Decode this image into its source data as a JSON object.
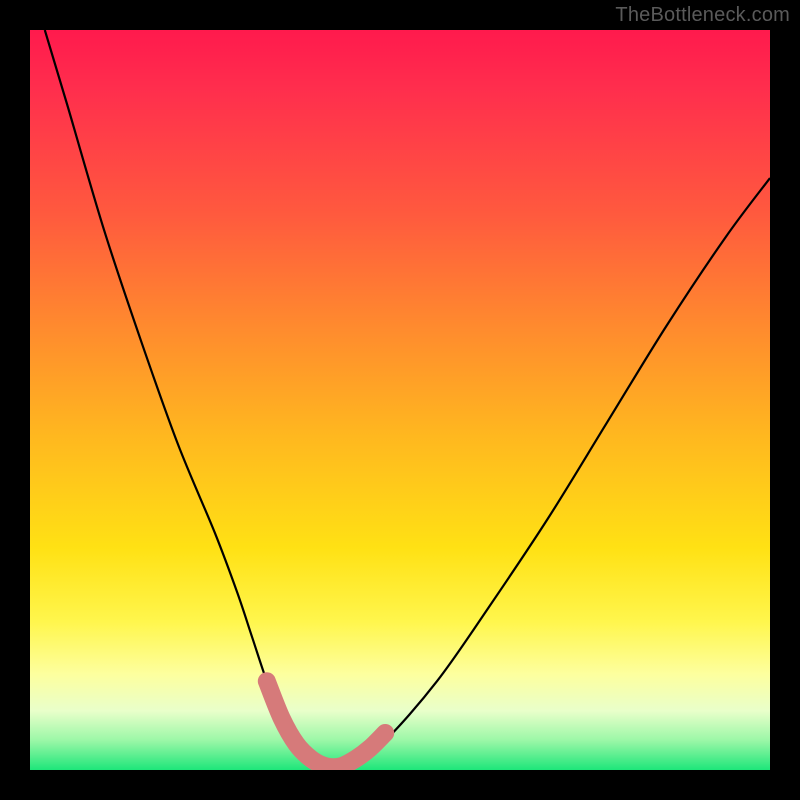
{
  "watermark": "TheBottleneck.com",
  "chart_data": {
    "type": "line",
    "title": "",
    "xlabel": "",
    "ylabel": "",
    "xlim": [
      0,
      100
    ],
    "ylim": [
      0,
      100
    ],
    "grid": false,
    "legend": false,
    "series": [
      {
        "name": "bottleneck-curve",
        "color": "#000000",
        "x": [
          2,
          5,
          10,
          15,
          20,
          25,
          28,
          30,
          32,
          34,
          36,
          38,
          40,
          42,
          44,
          48,
          55,
          62,
          70,
          78,
          86,
          94,
          100
        ],
        "values": [
          100,
          90,
          73,
          58,
          44,
          32,
          24,
          18,
          12,
          7,
          3.5,
          1.5,
          0.5,
          0.5,
          1.5,
          4,
          12,
          22,
          34,
          47,
          60,
          72,
          80
        ]
      }
    ],
    "annotations": [
      {
        "name": "trough-marker",
        "color": "#d67a7a",
        "shape": "rounded-v",
        "points_x": [
          32,
          34,
          36,
          38,
          40,
          42,
          44,
          46,
          48
        ],
        "points_y": [
          12,
          7,
          3.5,
          1.5,
          0.5,
          0.5,
          1.5,
          3,
          5
        ]
      }
    ]
  }
}
